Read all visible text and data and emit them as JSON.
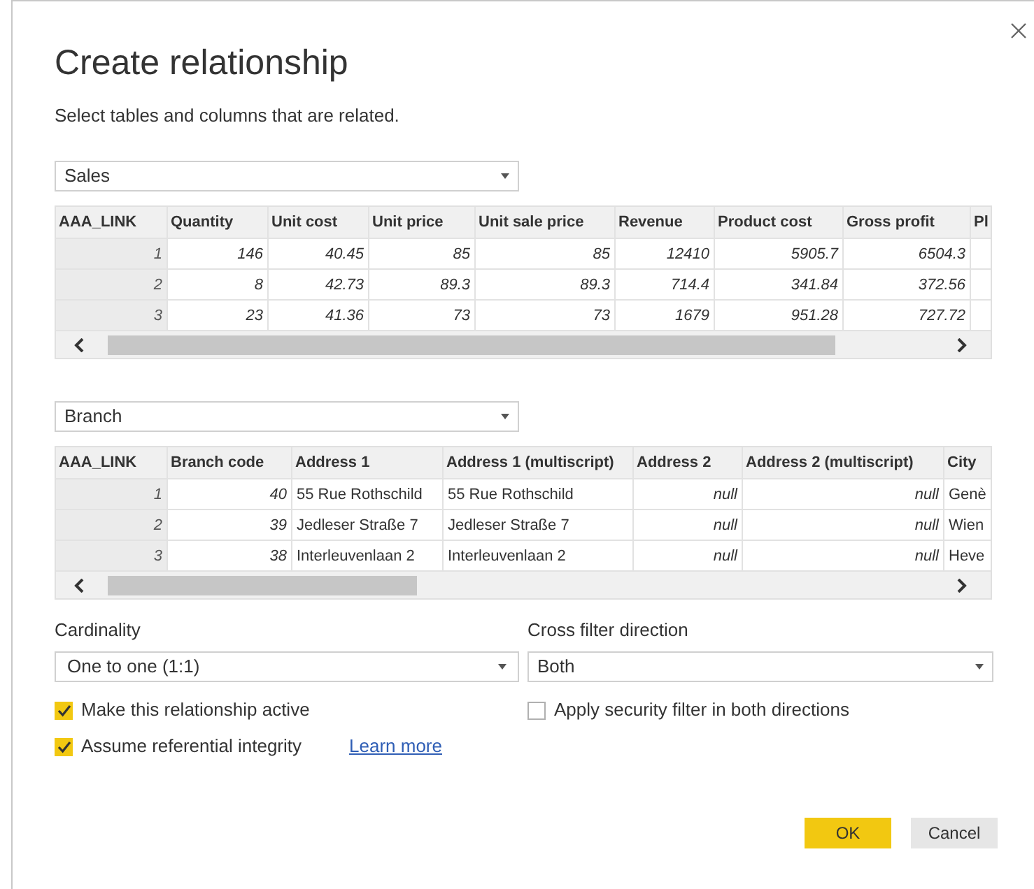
{
  "dialog": {
    "title": "Create relationship",
    "subtitle": "Select tables and columns that are related."
  },
  "tables": [
    {
      "dropdown": "Sales",
      "columns": [
        {
          "label": "AAA_LINK",
          "kind": "index"
        },
        {
          "label": "Quantity",
          "kind": "number"
        },
        {
          "label": "Unit cost",
          "kind": "number"
        },
        {
          "label": "Unit price",
          "kind": "number"
        },
        {
          "label": "Unit sale price",
          "kind": "number"
        },
        {
          "label": "Revenue",
          "kind": "number"
        },
        {
          "label": "Product cost",
          "kind": "number"
        },
        {
          "label": "Gross profit",
          "kind": "number"
        },
        {
          "label": "Pl",
          "kind": "text"
        }
      ],
      "rows": [
        [
          "1",
          "146",
          "40.45",
          "85",
          "85",
          "12410",
          "5905.7",
          "6504.3",
          ""
        ],
        [
          "2",
          "8",
          "42.73",
          "89.3",
          "89.3",
          "714.4",
          "341.84",
          "372.56",
          ""
        ],
        [
          "3",
          "23",
          "41.36",
          "73",
          "73",
          "1679",
          "951.28",
          "727.72",
          ""
        ]
      ]
    },
    {
      "dropdown": "Branch",
      "columns": [
        {
          "label": "AAA_LINK",
          "kind": "index"
        },
        {
          "label": "Branch code",
          "kind": "number"
        },
        {
          "label": "Address 1",
          "kind": "text"
        },
        {
          "label": "Address 1 (multiscript)",
          "kind": "text"
        },
        {
          "label": "Address 2",
          "kind": "number"
        },
        {
          "label": "Address 2 (multiscript)",
          "kind": "number"
        },
        {
          "label": "City",
          "kind": "text"
        }
      ],
      "rows": [
        [
          "1",
          "40",
          "55 Rue Rothschild",
          "55 Rue Rothschild",
          "null",
          "null",
          "Genè"
        ],
        [
          "2",
          "39",
          "Jedleser Straße 7",
          "Jedleser Straße 7",
          "null",
          "null",
          "Wien"
        ],
        [
          "3",
          "38",
          "Interleuvenlaan 2",
          "Interleuvenlaan 2",
          "null",
          "null",
          "Heve"
        ]
      ]
    }
  ],
  "cardinality": {
    "label": "Cardinality",
    "value": "One to one (1:1)"
  },
  "cross_filter": {
    "label": "Cross filter direction",
    "value": "Both"
  },
  "options_left": [
    {
      "label": "Make this relationship active",
      "checked": true
    },
    {
      "label": "Assume referential integrity",
      "checked": true,
      "link": "Learn more"
    }
  ],
  "options_right": [
    {
      "label": "Apply security filter in both directions",
      "checked": false
    }
  ],
  "buttons": [
    {
      "label": "OK",
      "kind": "primary"
    },
    {
      "label": "Cancel",
      "kind": "secondary"
    }
  ]
}
